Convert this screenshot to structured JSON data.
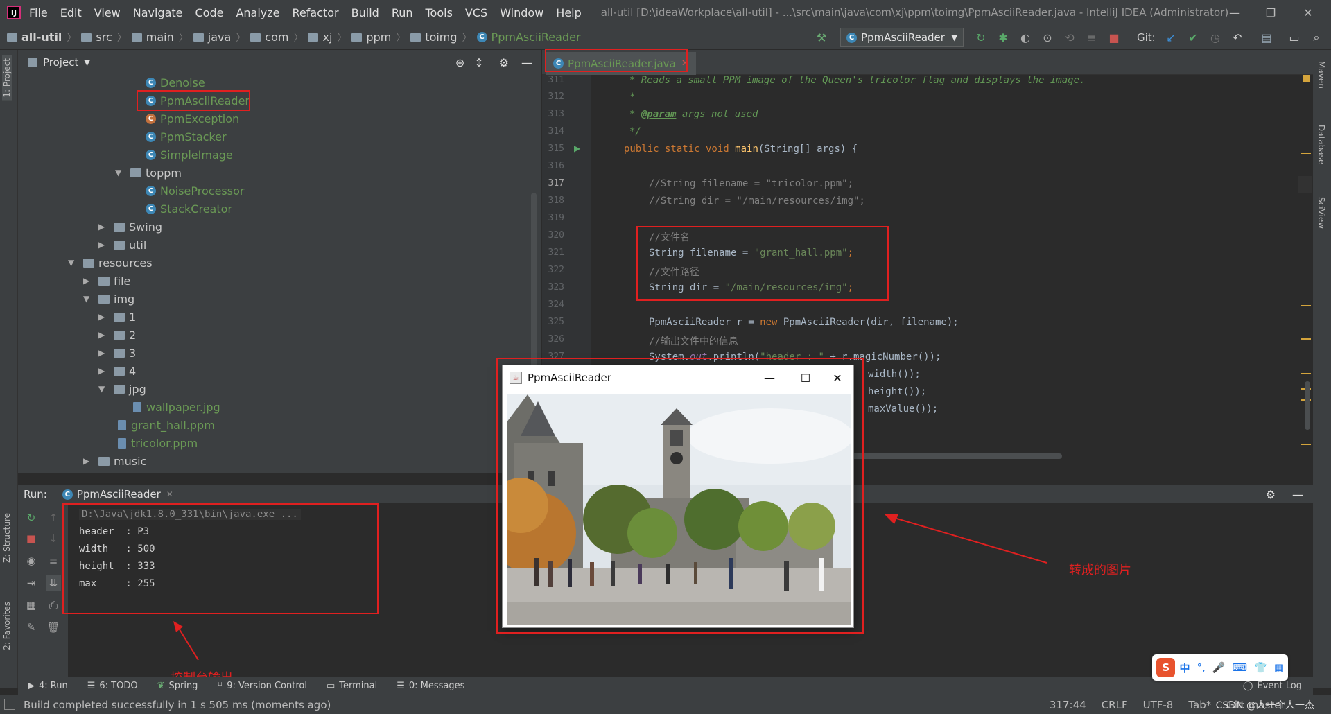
{
  "menubar": {
    "items": [
      "File",
      "Edit",
      "View",
      "Navigate",
      "Code",
      "Analyze",
      "Refactor",
      "Build",
      "Run",
      "Tools",
      "VCS",
      "Window",
      "Help"
    ],
    "window_title": "all-util [D:\\ideaWorkplace\\all-util] - ...\\src\\main\\java\\com\\xj\\ppm\\toimg\\PpmAsciiReader.java - IntelliJ IDEA (Administrator)"
  },
  "breadcrumb": [
    "all-util",
    "src",
    "main",
    "java",
    "com",
    "xj",
    "ppm",
    "toimg",
    "PpmAsciiReader"
  ],
  "toolbar": {
    "run_config": "PpmAsciiReader",
    "git_label": "Git:"
  },
  "left_strip": {
    "project": "1: Project",
    "structure": "Z: Structure",
    "favorites": "2: Favorites"
  },
  "right_strip": {
    "maven": "Maven",
    "database": "Database",
    "sciview": "SciView"
  },
  "project": {
    "header": "Project",
    "tree": [
      {
        "label": "Denoise",
        "kind": "class"
      },
      {
        "label": "PpmAsciiReader",
        "kind": "class"
      },
      {
        "label": "PpmException",
        "kind": "class"
      },
      {
        "label": "PpmStacker",
        "kind": "class"
      },
      {
        "label": "SimpleImage",
        "kind": "class"
      },
      {
        "label": "toppm",
        "kind": "folder"
      },
      {
        "label": "NoiseProcessor",
        "kind": "class"
      },
      {
        "label": "StackCreator",
        "kind": "class"
      },
      {
        "label": "Swing",
        "kind": "folder"
      },
      {
        "label": "util",
        "kind": "folder"
      },
      {
        "label": "resources",
        "kind": "folder"
      },
      {
        "label": "file",
        "kind": "folder"
      },
      {
        "label": "img",
        "kind": "folder"
      },
      {
        "label": "1",
        "kind": "folder"
      },
      {
        "label": "2",
        "kind": "folder"
      },
      {
        "label": "3",
        "kind": "folder"
      },
      {
        "label": "4",
        "kind": "folder"
      },
      {
        "label": "jpg",
        "kind": "folder"
      },
      {
        "label": "wallpaper.jpg",
        "kind": "file"
      },
      {
        "label": "grant_hall.ppm",
        "kind": "file"
      },
      {
        "label": "tricolor.ppm",
        "kind": "file"
      },
      {
        "label": "music",
        "kind": "folder"
      }
    ]
  },
  "editor": {
    "tab": "PpmAsciiReader.java",
    "line_numbers": [
      "311",
      "312",
      "313",
      "314",
      "315",
      "316",
      "317",
      "318",
      "319",
      "320",
      "321",
      "322",
      "323",
      "324",
      "325",
      "326",
      "327"
    ],
    "doc_311": "* Reads a small PPM image of the Queen's tricolor flag and displays the image.",
    "doc_312": "*",
    "doc_313_tag": "@param",
    "doc_313_rest": " args not used",
    "doc_314": "*/",
    "l315_kw": "public static void ",
    "l315_fn": "main",
    "l315_rest": "(String[] args) {",
    "l317": "//String filename = \"tricolor.ppm\";",
    "l318": "//String dir = \"/main/resources/img\";",
    "l320": "//文件名",
    "l321_a": "String filename = ",
    "l321_s": "\"grant_hall.ppm\"",
    "l321_e": ";",
    "l322": "//文件路径",
    "l323_a": "String dir = ",
    "l323_s": "\"/main/resources/img\"",
    "l323_e": ";",
    "l325_a": "PpmAsciiReader r = ",
    "l325_kw": "new ",
    "l325_b": "PpmAsciiReader(dir, filename);",
    "l326": "//输出文件中的信息",
    "l327_a": "System.",
    "l327_f": "out",
    "l327_b": ".println(",
    "l327_s": "\"header : \"",
    "l327_c": " + r.magicNumber());",
    "l328": "width());",
    "l329": "height());",
    "l330": "maxValue());"
  },
  "run": {
    "label": "Run:",
    "tab": "PpmAsciiReader",
    "console": [
      "D:\\Java\\jdk1.8.0_331\\bin\\java.exe ...",
      "header  : P3",
      "width   : 500",
      "height  : 333",
      "max     : 255"
    ]
  },
  "java_window": {
    "title": "PpmAsciiReader"
  },
  "annotations": {
    "converted_image": "转成的图片",
    "console_output": "控制台输出"
  },
  "bottom_tabs": [
    "4: Run",
    "6: TODO",
    "Spring",
    "9: Version Control",
    "Terminal",
    "0: Messages"
  ],
  "event_log": "Event Log",
  "status": {
    "message": "Build completed successfully in 1 s 505 ms (moments ago)",
    "position": "317:44",
    "line_sep": "CRLF",
    "encoding": "UTF-8",
    "indent": "Tab*",
    "git": "Git: master",
    "watermark": "CSDN @人一个人一杰"
  },
  "ime": {
    "logo": "S",
    "items": [
      "中",
      "°,",
      "🎤",
      "⌨",
      "👕",
      "▦"
    ]
  },
  "colors": {
    "accent_red": "#e02020",
    "class_green": "#6a9955",
    "selection": "#0d293e"
  }
}
